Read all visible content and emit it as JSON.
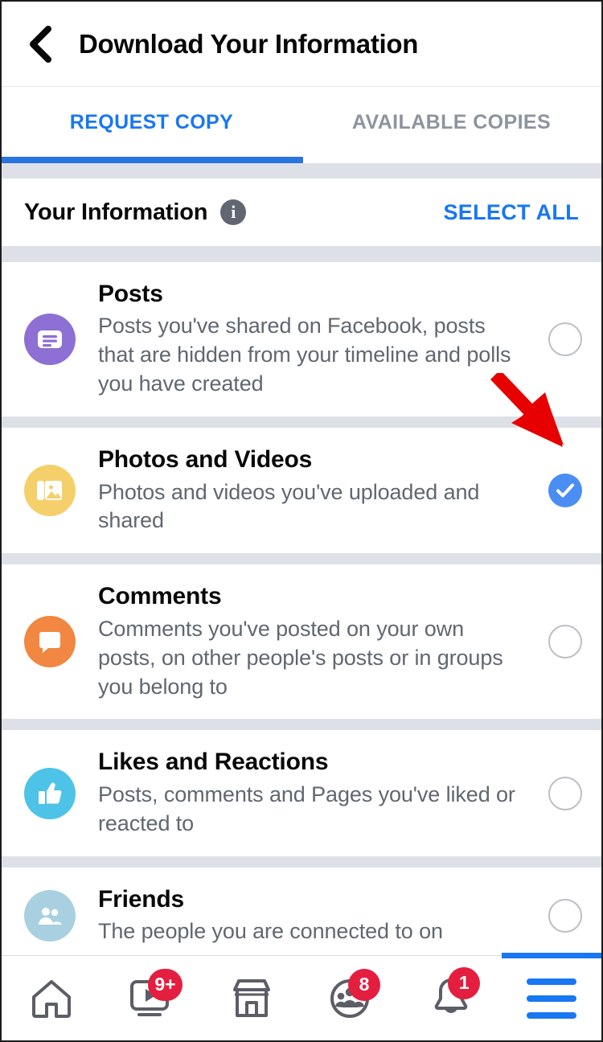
{
  "header": {
    "back_icon": "back-chevron-icon",
    "title": "Download Your Information"
  },
  "tabs": [
    {
      "label": "REQUEST COPY",
      "active": true
    },
    {
      "label": "AVAILABLE COPIES",
      "active": false
    }
  ],
  "section": {
    "title": "Your Information",
    "info_icon": "info-icon",
    "select_all_label": "SELECT ALL"
  },
  "rows": [
    {
      "title": "Posts",
      "description": "Posts you've shared on Facebook, posts that are hidden from your timeline and polls you have created",
      "icon": "posts-icon",
      "icon_bg": "#8e6fd4",
      "checked": false
    },
    {
      "title": "Photos and Videos",
      "description": "Photos and videos you've uploaded and shared",
      "icon": "photos-videos-icon",
      "icon_bg": "#f5d06a",
      "checked": true
    },
    {
      "title": "Comments",
      "description": "Comments you've posted on your own posts, on other people's posts or in groups you belong to",
      "icon": "comments-icon",
      "icon_bg": "#f18740",
      "checked": false
    },
    {
      "title": "Likes and Reactions",
      "description": "Posts, comments and Pages you've liked or reacted to",
      "icon": "thumbs-up-icon",
      "icon_bg": "#4ec3e8",
      "checked": false
    },
    {
      "title": "Friends",
      "description": "The people you are connected to on",
      "icon": "friends-icon",
      "icon_bg": "#a8d0e0",
      "checked": false
    }
  ],
  "annotation": {
    "type": "red-arrow",
    "color": "#e60000",
    "points_to": "Photos and Videos checkbox"
  },
  "bottom_nav": [
    {
      "icon": "home-icon",
      "badge": ""
    },
    {
      "icon": "watch-icon",
      "badge": "9+"
    },
    {
      "icon": "marketplace-icon",
      "badge": ""
    },
    {
      "icon": "groups-icon",
      "badge": "8"
    },
    {
      "icon": "notifications-bell-icon",
      "badge": "1"
    },
    {
      "icon": "menu-hamburger-icon",
      "badge": ""
    }
  ],
  "colors": {
    "accent_blue": "#1877f2",
    "checked_blue": "#4a8df3",
    "badge_red": "#e41e3f",
    "separator_gray": "#dde1e7",
    "text_secondary": "#606770",
    "tab_inactive": "#8d949e"
  }
}
